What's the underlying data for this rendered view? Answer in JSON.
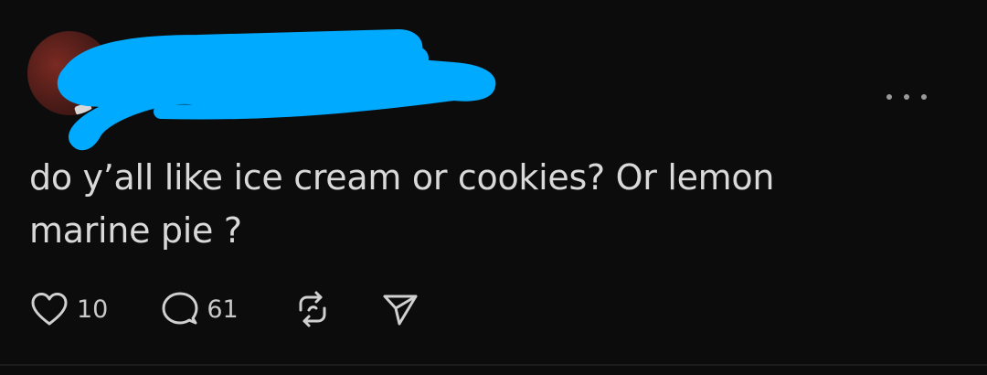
{
  "post": {
    "text": "do y’all like ice cream or cookies? Or lemon marine pie ?",
    "more_icon": "ellipsis-icon",
    "avatar": "redacted-avatar",
    "redaction_color": "#00aaff"
  },
  "actions": {
    "like": {
      "icon": "heart-icon",
      "count": "10"
    },
    "reply": {
      "icon": "comment-icon",
      "count": "61"
    },
    "repost": {
      "icon": "repost-icon"
    },
    "share": {
      "icon": "send-icon"
    }
  },
  "colors": {
    "background": "#0c0c0d",
    "text": "#d9d9d9",
    "muted": "#9a9a9a"
  }
}
